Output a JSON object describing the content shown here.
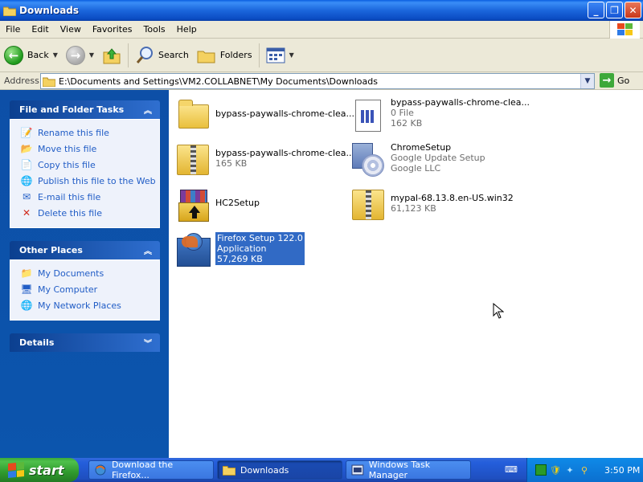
{
  "window": {
    "title": "Downloads"
  },
  "menu": {
    "items": [
      "File",
      "Edit",
      "View",
      "Favorites",
      "Tools",
      "Help"
    ]
  },
  "toolbar": {
    "back": "Back",
    "search": "Search",
    "folders": "Folders"
  },
  "address": {
    "label": "Address",
    "path": "E:\\Documents and Settings\\VM2.COLLABNET\\My Documents\\Downloads",
    "go": "Go"
  },
  "left": {
    "file_tasks": {
      "title": "File and Folder Tasks",
      "items": [
        "Rename this file",
        "Move this file",
        "Copy this file",
        "Publish this file to the Web",
        "E-mail this file",
        "Delete this file"
      ]
    },
    "other_places": {
      "title": "Other Places",
      "items": [
        "My Documents",
        "My Computer",
        "My Network Places"
      ]
    },
    "details": {
      "title": "Details"
    }
  },
  "files": [
    {
      "name": "bypass-paywalls-chrome-clea...",
      "line2": "",
      "line3": ""
    },
    {
      "name": "bypass-paywalls-chrome-clea...",
      "line2": "0 File",
      "line3": "162 KB"
    },
    {
      "name": "bypass-paywalls-chrome-clea...",
      "line2": "165 KB",
      "line3": ""
    },
    {
      "name": "ChromeSetup",
      "line2": "Google Update Setup",
      "line3": "Google LLC"
    },
    {
      "name": "HC2Setup",
      "line2": "",
      "line3": ""
    },
    {
      "name": "mypal-68.13.8.en-US.win32",
      "line2": "61,123 KB",
      "line3": ""
    },
    {
      "name": "Firefox Setup 122.0",
      "line2": "Application",
      "line3": "57,269 KB"
    }
  ],
  "taskbar": {
    "start": "start",
    "buttons": [
      "Download the Firefox...",
      "Downloads",
      "Windows Task Manager"
    ],
    "clock": "3:50 PM"
  },
  "colors": {
    "title_blue": "#0b4cc3",
    "pane_blue": "#0c55ad",
    "task_link": "#215dc6",
    "selection": "#316ac5",
    "taskbar_blue": "#245edb",
    "start_green": "#3aa93a"
  }
}
